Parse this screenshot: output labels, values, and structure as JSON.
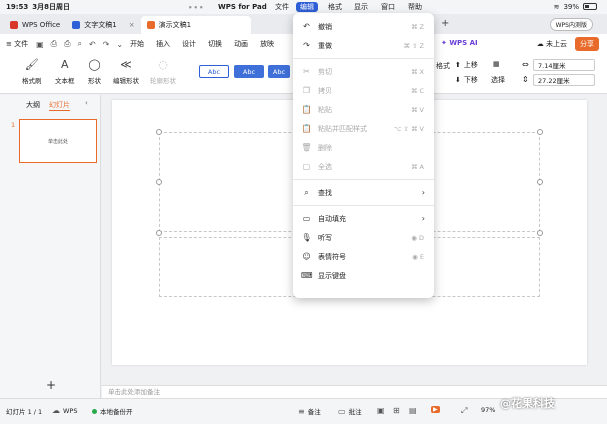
{
  "status_bar": {
    "time": "19:53",
    "date": "3月8日周日",
    "dots": "•••",
    "app_name": "WPS for Pad",
    "menus": [
      "文件",
      "编辑",
      "格式",
      "显示",
      "窗口",
      "帮助"
    ],
    "active_menu": "编辑",
    "battery": "39%"
  },
  "tabs": [
    {
      "label": "WPS Office",
      "color": "#d9352b"
    },
    {
      "label": "文字文稿1",
      "color": "#2e5fd7"
    },
    {
      "label": "演示文稿1",
      "color": "#e86b2b",
      "active": true
    }
  ],
  "tabbar": {
    "plus": "+",
    "pill": "WPS内测版"
  },
  "ribbon": {
    "file": "≡ 文件",
    "tabs": [
      "开始",
      "插入",
      "设计",
      "切换",
      "动画",
      "放映"
    ],
    "wps_ai": "WPS AI",
    "cloud": "未上云",
    "share": "分享"
  },
  "toolbar": {
    "format_painter": "格式刷",
    "textbox": "文本框",
    "shape": "形状",
    "edit_shape": "编辑形状",
    "outline_shape": "轮廓形状",
    "style_labels": [
      "Abc",
      "Abc",
      "Abc"
    ],
    "text_tool": "格式",
    "up_layer": "上移",
    "down_layer": "下移",
    "select": "选择",
    "width": "7.14厘米",
    "height": "27.22厘米"
  },
  "left_panel": {
    "tabs": [
      "大纲",
      "幻灯片"
    ],
    "active_tab": "幻灯片",
    "slide_number": "1",
    "thumb_title": "单击此处",
    "add": "+"
  },
  "notes_placeholder": "单击此处添加备注",
  "bottom_bar": {
    "slide_count": "幻灯片 1 / 1",
    "wps": "WPS",
    "backup": "本地备份开",
    "notes": "备注",
    "comments": "批注",
    "zoom": "97%"
  },
  "watermark": "@花果科技",
  "edit_menu": {
    "groups": [
      [
        {
          "icon": "undo-icon",
          "glyph": "↶",
          "label": "撤销",
          "shortcut": "⌘ Z",
          "enabled": true
        },
        {
          "icon": "redo-icon",
          "glyph": "↷",
          "label": "重做",
          "shortcut": "⌘ ⇧ Z",
          "enabled": true
        }
      ],
      [
        {
          "icon": "scissors-icon",
          "glyph": "✂",
          "label": "剪切",
          "shortcut": "⌘ X",
          "enabled": false
        },
        {
          "icon": "copy-icon",
          "glyph": "❐",
          "label": "拷贝",
          "shortcut": "⌘ C",
          "enabled": false
        },
        {
          "icon": "paste-icon",
          "glyph": "📋",
          "label": "粘贴",
          "shortcut": "⌘ V",
          "enabled": false
        },
        {
          "icon": "paste-match-icon",
          "glyph": "📋",
          "label": "粘贴并匹配样式",
          "shortcut": "⌥ ⇧ ⌘ V",
          "enabled": false
        },
        {
          "icon": "trash-icon",
          "glyph": "🗑",
          "label": "删除",
          "shortcut": "",
          "enabled": false
        },
        {
          "icon": "select-all-icon",
          "glyph": "▢",
          "label": "全选",
          "shortcut": "⌘ A",
          "enabled": false
        }
      ],
      [
        {
          "icon": "find-icon",
          "glyph": "⌕",
          "label": "查找",
          "submenu": true,
          "enabled": true
        }
      ],
      [
        {
          "icon": "autofill-icon",
          "glyph": "▭",
          "label": "自动填充",
          "submenu": true,
          "enabled": true
        },
        {
          "icon": "mic-icon",
          "glyph": "🎙",
          "label": "听写",
          "shortcut": "◉ D",
          "enabled": true
        },
        {
          "icon": "emoji-icon",
          "glyph": "☺",
          "label": "表情符号",
          "shortcut": "◉ E",
          "enabled": true
        },
        {
          "icon": "keyboard-icon",
          "glyph": "⌨",
          "label": "显示键盘",
          "shortcut": "",
          "enabled": true
        }
      ]
    ]
  }
}
